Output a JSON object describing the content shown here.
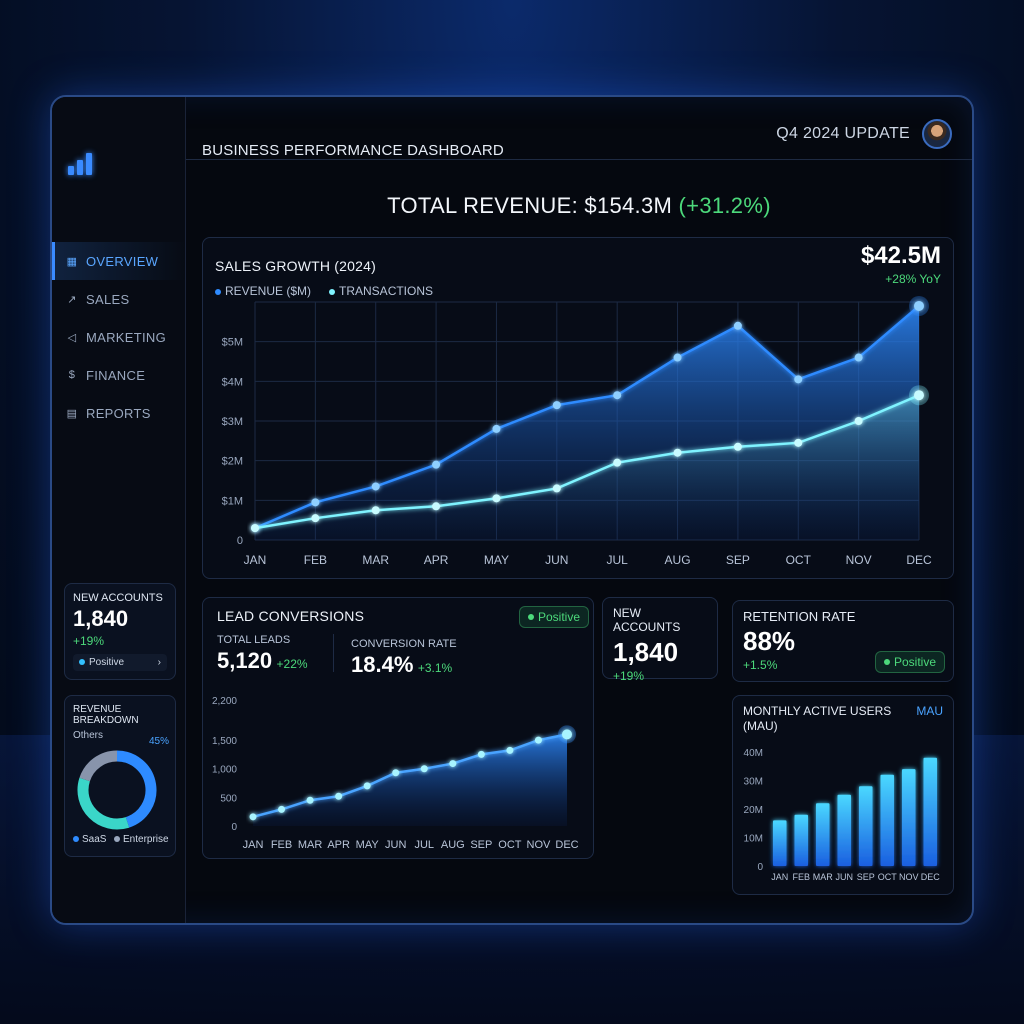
{
  "header": {
    "title": "BUSINESS PERFORMANCE DASHBOARD",
    "update": "Q4 2024 UPDATE",
    "total_revenue_label": "TOTAL REVENUE: $154.3M",
    "total_revenue_change": "(+31.2%)"
  },
  "sidebar": {
    "items": [
      {
        "label": "OVERVIEW",
        "icon": "grid-icon",
        "active": true
      },
      {
        "label": "SALES",
        "icon": "trend-icon"
      },
      {
        "label": "MARKETING",
        "icon": "megaphone-icon"
      },
      {
        "label": "FINANCE",
        "icon": "dollar-icon"
      },
      {
        "label": "REPORTS",
        "icon": "document-icon"
      }
    ],
    "new_accounts": {
      "title": "NEW ACCOUNTS",
      "value": "1,840",
      "delta": "+19%",
      "status": "Positive"
    },
    "revenue_breakdown": {
      "title": "REVENUE BREAKDOWN",
      "others_label": "Others",
      "pct_label": "45%",
      "legend": [
        "SaaS",
        "Enterprise"
      ]
    }
  },
  "sales_growth": {
    "title": "SALES GROWTH (2024)",
    "legend": [
      "REVENUE ($M)",
      "TRANSACTIONS"
    ],
    "headline": "$42.5M",
    "headline_delta": "+28% YoY"
  },
  "lead_conversions": {
    "title": "LEAD CONVERSIONS",
    "status": "Positive",
    "total_leads_label": "TOTAL LEADS",
    "total_leads": "5,120",
    "total_leads_delta": "+22%",
    "conversion_label": "CONVERSION RATE",
    "conversion": "18.4%",
    "conversion_delta": "+3.1%"
  },
  "new_accounts": {
    "title": "NEW ACCOUNTS",
    "value": "1,840",
    "delta": "+19%"
  },
  "retention": {
    "title": "RETENTION RATE",
    "value": "88%",
    "delta": "+1.5%",
    "status": "Positive"
  },
  "mau": {
    "title": "MONTHLY ACTIVE USERS (MAU)",
    "tag": "MAU"
  },
  "colors": {
    "accent": "#3a8bff",
    "cyan": "#7ff3ff",
    "positive": "#4cd97b"
  },
  "chart_data": [
    {
      "type": "line",
      "title": "SALES GROWTH (2024)",
      "categories": [
        "JAN",
        "FEB",
        "MAR",
        "APR",
        "MAY",
        "JUN",
        "JUL",
        "AUG",
        "SEP",
        "OCT",
        "NOV",
        "DEC"
      ],
      "y_ticks": [
        "0",
        "$1M",
        "$2M",
        "$3M",
        "$4M",
        "$5M"
      ],
      "ylim": [
        0,
        6
      ],
      "series": [
        {
          "name": "REVENUE ($M)",
          "values": [
            0.3,
            0.95,
            1.35,
            1.9,
            2.8,
            3.4,
            3.65,
            4.6,
            5.4,
            4.05,
            4.6,
            5.9
          ]
        },
        {
          "name": "TRANSACTIONS",
          "values": [
            0.3,
            0.55,
            0.75,
            0.85,
            1.05,
            1.3,
            1.95,
            2.2,
            2.35,
            2.45,
            3.0,
            3.65
          ]
        }
      ]
    },
    {
      "type": "area",
      "title": "LEAD CONVERSIONS",
      "categories": [
        "JAN",
        "FEB",
        "MAR",
        "APR",
        "MAY",
        "JUN",
        "JUL",
        "AUG",
        "SEP",
        "OCT",
        "NOV",
        "DEC"
      ],
      "y_ticks": [
        "0",
        "500",
        "1,000",
        "1,500",
        "2,200"
      ],
      "ylim": [
        0,
        2200
      ],
      "values": [
        160,
        290,
        450,
        520,
        700,
        930,
        1000,
        1090,
        1250,
        1320,
        1500,
        1600
      ]
    },
    {
      "type": "bar",
      "title": "MONTHLY ACTIVE USERS (MAU)",
      "categories": [
        "JAN",
        "FEB",
        "MAR",
        "JUN",
        "SEP",
        "OCT",
        "NOV",
        "DEC"
      ],
      "y_ticks": [
        "0",
        "10M",
        "20M",
        "30M",
        "40M"
      ],
      "ylim": [
        0,
        40
      ],
      "values": [
        16,
        18,
        22,
        25,
        28,
        32,
        34,
        38
      ]
    },
    {
      "type": "pie",
      "title": "REVENUE BREAKDOWN",
      "labels": [
        "SaaS",
        "Enterprise",
        "Others"
      ],
      "values": [
        45,
        35,
        20
      ]
    }
  ]
}
